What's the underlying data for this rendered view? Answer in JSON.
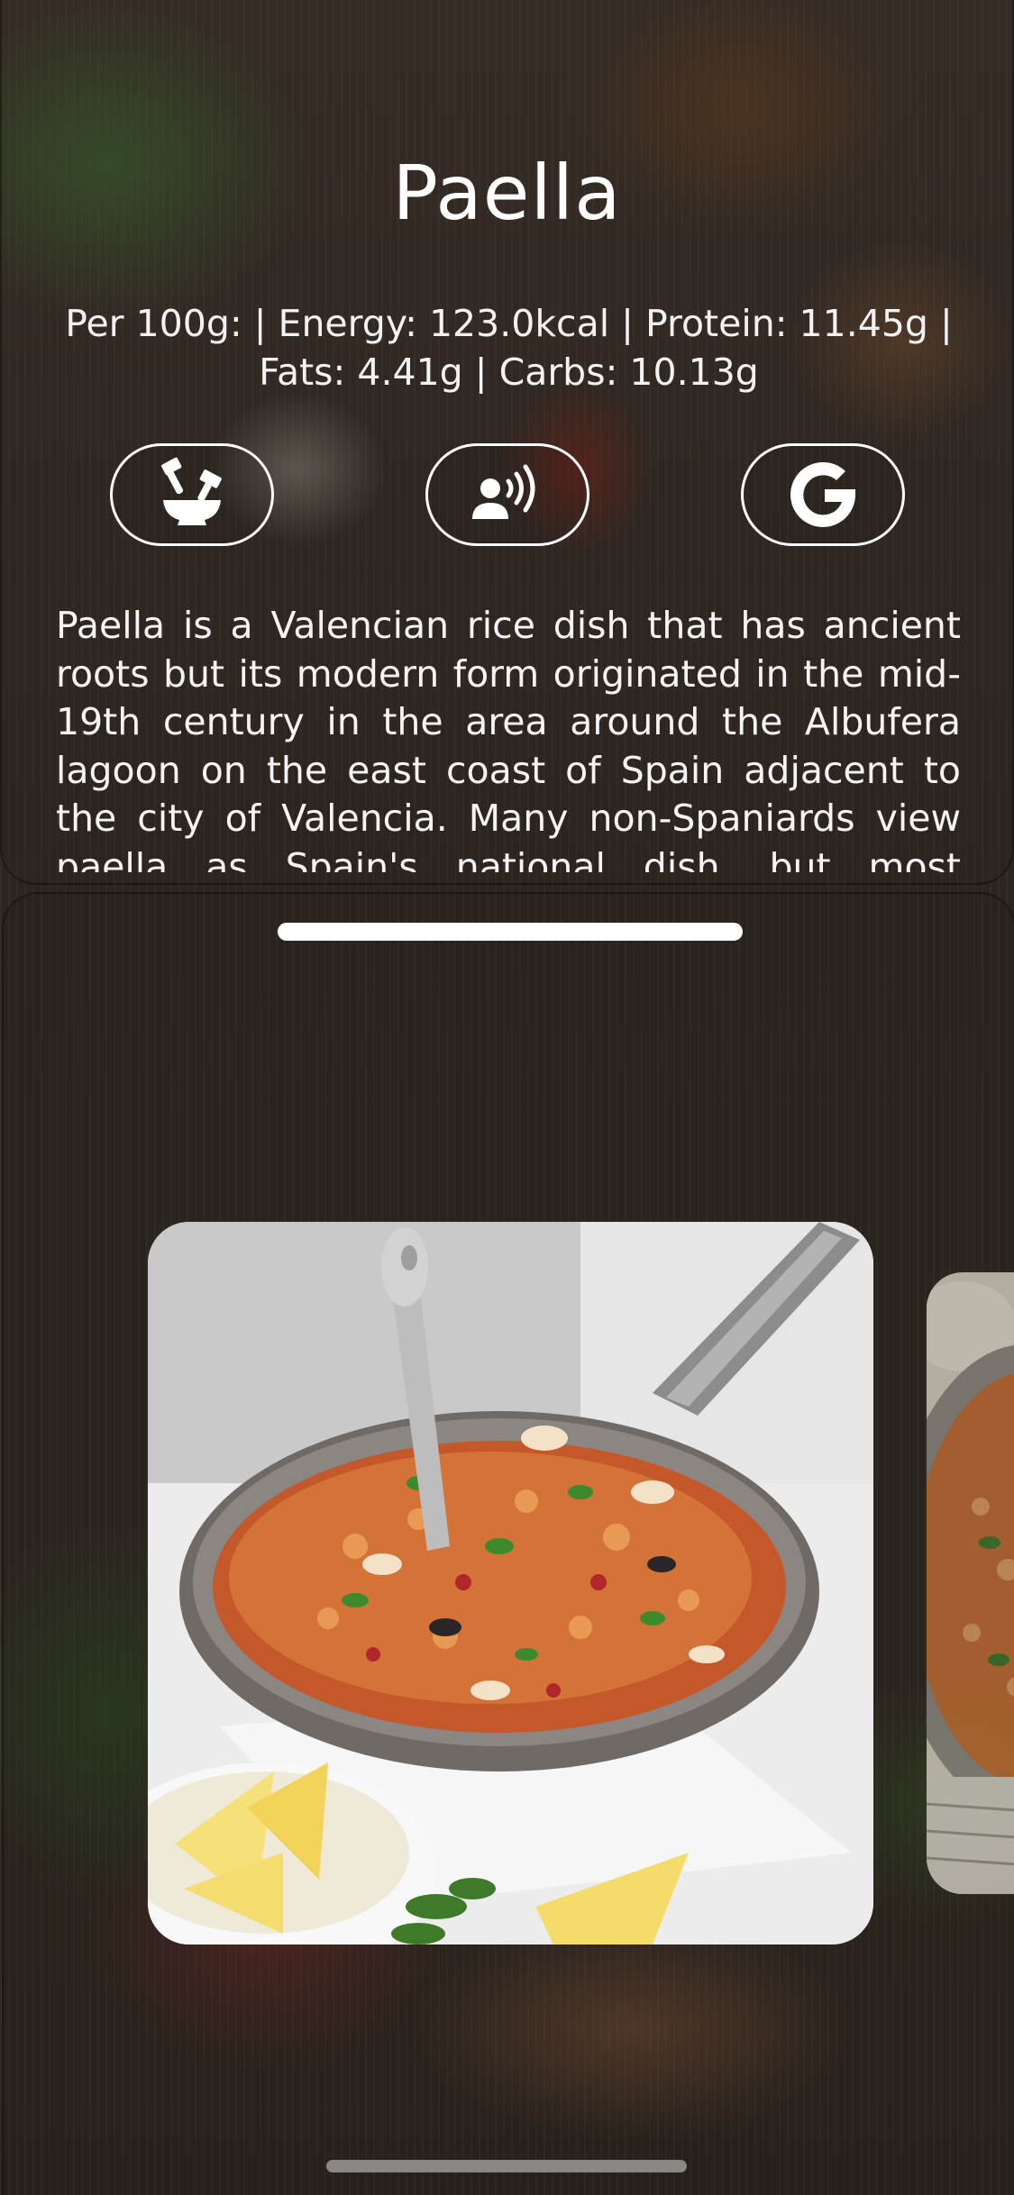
{
  "dish": {
    "title": "Paella",
    "nutrition": "Per 100g: | Energy: 123.0kcal | Protein: 11.45g | Fats: 4.41g | Carbs: 10.13g",
    "description": "Paella is a Valencian rice dish that has ancient roots but its modern form originated in the mid-19th century in the area around the Albufera lagoon on the east coast of Spain adjacent to the city of Valencia. Many non-Spaniards view paella as Spain's national dish, but most Spaniards consider it to be a regional Valencian dish."
  },
  "actions": [
    {
      "icon": "mortar-pestle-icon"
    },
    {
      "icon": "speaking-person-icon"
    },
    {
      "icon": "google-icon"
    }
  ],
  "colors": {
    "text": "#ffffff",
    "background": "#2d2620"
  }
}
